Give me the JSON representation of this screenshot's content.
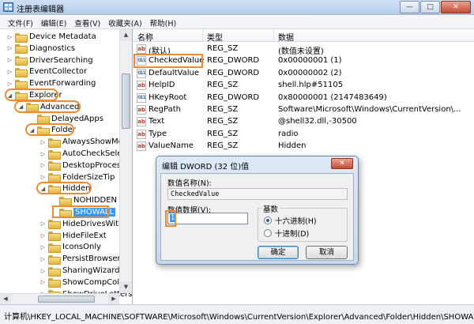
{
  "window": {
    "title": "注册表编辑器",
    "min_glyph": "—",
    "max_glyph": "□",
    "close_glyph": "✕"
  },
  "menu": [
    "文件(F)",
    "编辑(E)",
    "查看(V)",
    "收藏夹(A)",
    "帮助(H)"
  ],
  "tree": {
    "items": [
      {
        "label": "Device Metadata",
        "indent": 0,
        "expander": "▷"
      },
      {
        "label": "Diagnostics",
        "indent": 0,
        "expander": "▷"
      },
      {
        "label": "DriverSearching",
        "indent": 0,
        "expander": "▷"
      },
      {
        "label": "EventCollector",
        "indent": 0,
        "expander": "▷"
      },
      {
        "label": "EventForwarding",
        "indent": 0,
        "expander": "▷"
      },
      {
        "label": "Explorer",
        "indent": 0,
        "expander": "◢"
      },
      {
        "label": "Advanced",
        "indent": 1,
        "expander": "◢"
      },
      {
        "label": "DelayedApps",
        "indent": 2,
        "expander": ""
      },
      {
        "label": "Folder",
        "indent": 2,
        "expander": "◢"
      },
      {
        "label": "AlwaysShowMenu",
        "indent": 3,
        "expander": "▷"
      },
      {
        "label": "AutoCheckSelect",
        "indent": 3,
        "expander": "▷"
      },
      {
        "label": "DesktopProcess",
        "indent": 3,
        "expander": "▷"
      },
      {
        "label": "FolderSizeTip",
        "indent": 3,
        "expander": "▷"
      },
      {
        "label": "Hidden",
        "indent": 3,
        "expander": "◢"
      },
      {
        "label": "NOHIDDEN",
        "indent": 4,
        "expander": ""
      },
      {
        "label": "SHOWALL",
        "indent": 4,
        "expander": ""
      },
      {
        "label": "HideDrivesWithN",
        "indent": 3,
        "expander": "▷"
      },
      {
        "label": "HideFileExt",
        "indent": 3,
        "expander": "▷"
      },
      {
        "label": "IconsOnly",
        "indent": 3,
        "expander": "▷"
      },
      {
        "label": "PersistBrowsers",
        "indent": 3,
        "expander": "▷"
      },
      {
        "label": "SharingWizardOr",
        "indent": 3,
        "expander": "▷"
      },
      {
        "label": "ShowCompColor",
        "indent": 3,
        "expander": "▷"
      },
      {
        "label": "ShowDriveLetters",
        "indent": 3,
        "expander": "▷"
      }
    ],
    "scroll_up_glyph": "▲",
    "scroll_down_glyph": "▼",
    "scroll_left_glyph": "◀",
    "scroll_right_glyph": "▶"
  },
  "values": {
    "columns": [
      "名称",
      "类型",
      "数据"
    ],
    "rows": [
      {
        "name": "(默认)",
        "type": "REG_SZ",
        "data": "(数值未设置)",
        "icon": "ab"
      },
      {
        "name": "CheckedValue",
        "type": "REG_DWORD",
        "data": "0x00000001 (1)",
        "icon": "011"
      },
      {
        "name": "DefaultValue",
        "type": "REG_DWORD",
        "data": "0x00000002 (2)",
        "icon": "011"
      },
      {
        "name": "HelpID",
        "type": "REG_SZ",
        "data": "shell.hlp#51105",
        "icon": "ab"
      },
      {
        "name": "HKeyRoot",
        "type": "REG_DWORD",
        "data": "0x80000001 (2147483649)",
        "icon": "011"
      },
      {
        "name": "RegPath",
        "type": "REG_SZ",
        "data": "Software\\Microsoft\\Windows\\CurrentVersion\\...",
        "icon": "ab"
      },
      {
        "name": "Text",
        "type": "REG_SZ",
        "data": "@shell32.dll,-30500",
        "icon": "ab"
      },
      {
        "name": "Type",
        "type": "REG_SZ",
        "data": "radio",
        "icon": "ab"
      },
      {
        "name": "ValueName",
        "type": "REG_SZ",
        "data": "Hidden",
        "icon": "ab"
      }
    ]
  },
  "status": {
    "path": "计算机\\HKEY_LOCAL_MACHINE\\SOFTWARE\\Microsoft\\Windows\\CurrentVersion\\Explorer\\Advanced\\Folder\\Hidden\\SHOWALL"
  },
  "dialog": {
    "title": "编辑 DWORD (32 位)值",
    "close_glyph": "✕",
    "name_label": "数值名称(N):",
    "name_value": "CheckedValue",
    "data_label": "数值数据(V):",
    "data_value": "1",
    "base_label": "基数",
    "hex_label": "十六进制(H)",
    "dec_label": "十进制(D)",
    "base_selected": "hex",
    "ok_label": "确定",
    "cancel_label": "取消"
  }
}
